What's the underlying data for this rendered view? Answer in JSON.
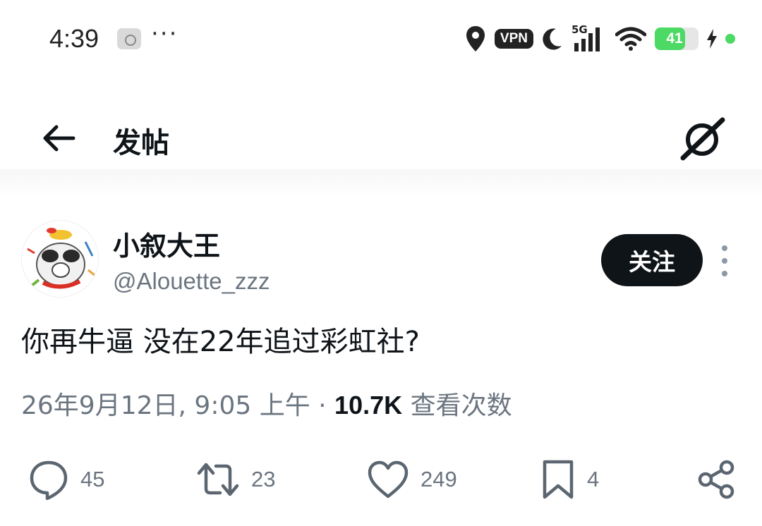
{
  "status_bar": {
    "time": "4:39",
    "dots": "···",
    "vpn": "VPN",
    "network": "5G",
    "battery": "41",
    "battery_level": 0.41,
    "accent": "#4cd964"
  },
  "header": {
    "title": "发帖",
    "back_icon": "arrow-left-icon",
    "grok_icon": "grok-icon"
  },
  "author": {
    "name": "小叙大王",
    "handle": "@Alouette_zzz",
    "follow_label": "关注"
  },
  "post": {
    "text": "你再牛逼 没在22年追过彩虹社?",
    "timestamp": "26年9月12日, 9:05 上午 ·",
    "views": "10.7K",
    "views_label": "查看次数"
  },
  "actions": {
    "replies": "45",
    "reposts": "23",
    "likes": "249",
    "bookmarks": "4"
  }
}
